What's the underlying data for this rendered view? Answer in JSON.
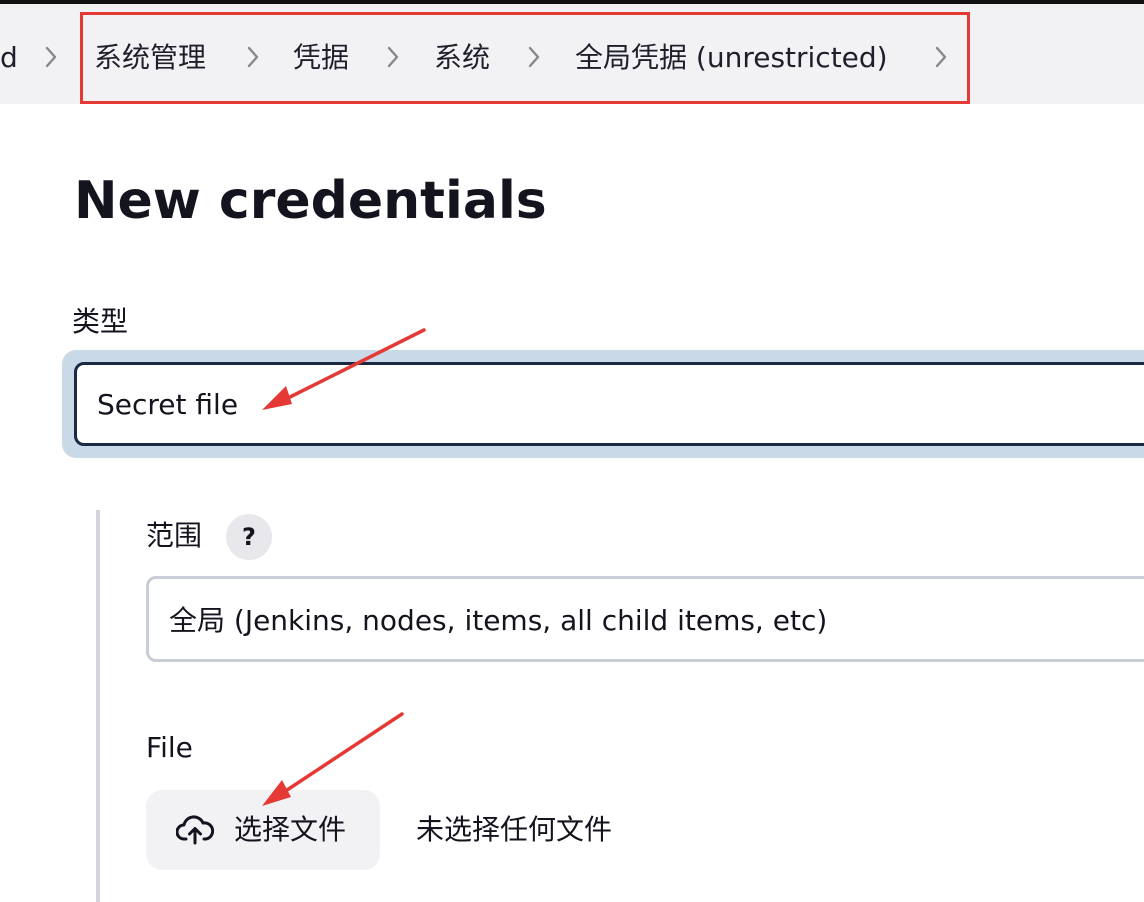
{
  "breadcrumb": {
    "items": [
      {
        "label": "d"
      },
      {
        "label": "系统管理"
      },
      {
        "label": "凭据"
      },
      {
        "label": "系统"
      },
      {
        "label": "全局凭据 (unrestricted)"
      }
    ]
  },
  "page": {
    "title": "New credentials"
  },
  "form": {
    "type_label": "类型",
    "type_value": "Secret file",
    "scope_label": "范围",
    "scope_help": "?",
    "scope_value": "全局 (Jenkins, nodes, items, all child items, etc)",
    "file_label": "File",
    "file_button_label": "选择文件",
    "file_status": "未选择任何文件"
  },
  "icons": {
    "chevron": "chevron-right-icon",
    "help": "help-icon",
    "upload": "cloud-upload-icon"
  },
  "colors": {
    "annotation_red": "#e53935",
    "select_border": "#1b2a44",
    "focus_ring": "#c9d9e8",
    "breadcrumb_bg": "#f2f2f5"
  }
}
